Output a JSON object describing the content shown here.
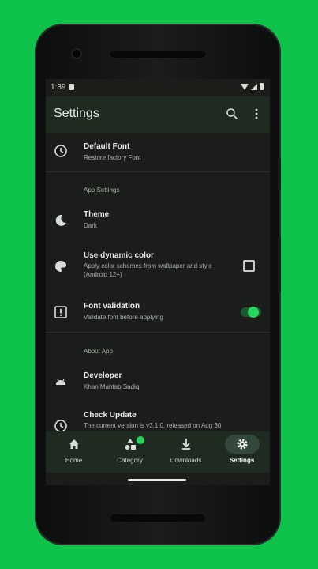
{
  "status": {
    "time": "1:39"
  },
  "appbar": {
    "title": "Settings"
  },
  "settings": {
    "default_font": {
      "title": "Default Font",
      "subtitle": "Restore factory Font"
    },
    "app_settings_header": "App Settings",
    "theme": {
      "title": "Theme",
      "subtitle": "Dark"
    },
    "dynamic_color": {
      "title": "Use dynamic color",
      "subtitle": "Apply color schemes from wallpaper and style (Android 12+)",
      "checked": false
    },
    "font_validation": {
      "title": "Font validation",
      "subtitle": "Validate font before applying",
      "enabled": true
    },
    "about_header": "About App",
    "developer": {
      "title": "Developer",
      "subtitle": "Khan Mahtab Sadiq"
    },
    "check_update": {
      "title": "Check Update",
      "subtitle": "The current version is v3.1.0, released on Aug 30"
    }
  },
  "nav": {
    "items": [
      {
        "label": "Home"
      },
      {
        "label": "Category"
      },
      {
        "label": "Downloads"
      },
      {
        "label": "Settings"
      }
    ],
    "active": "Settings"
  },
  "colors": {
    "accent": "#28d35b",
    "background": "#0ec24a",
    "surface": "#1a1d1a",
    "bar": "#1f2a21"
  }
}
